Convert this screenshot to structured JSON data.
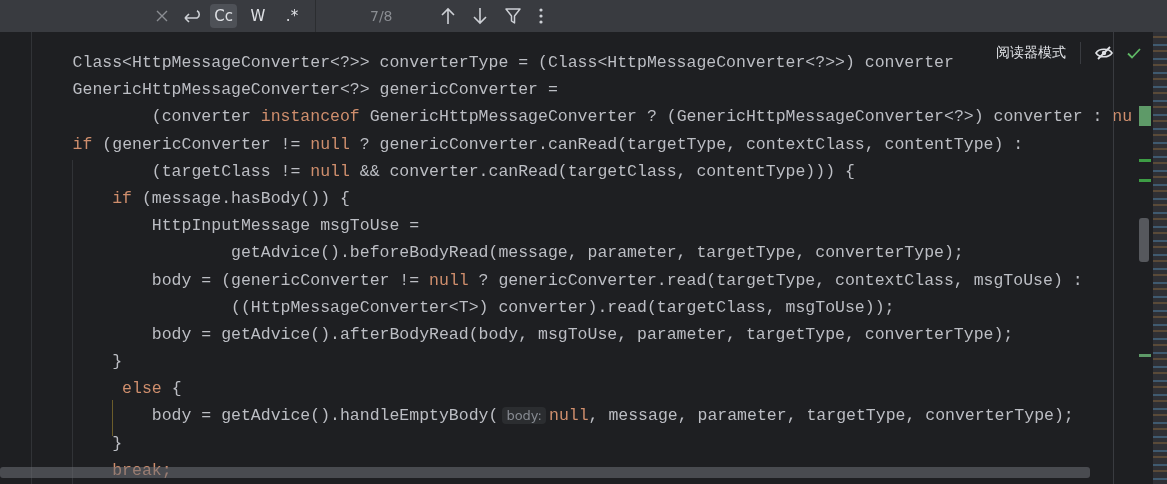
{
  "find_bar": {
    "options": [
      {
        "label": "Cc",
        "selected": true
      },
      {
        "label": "W",
        "selected": false
      },
      {
        "label": ".*",
        "selected": false
      }
    ],
    "match_count": "7/8"
  },
  "reader_mode": {
    "label": "阅读器模式"
  },
  "code_lines": [
    {
      "tokens": [
        {
          "kind": "plain",
          "text": "    Class<HttpMessageConverter<?>> converterType = (Class<HttpMessageConverter<?>>) converter"
        }
      ]
    },
    {
      "tokens": [
        {
          "kind": "plain",
          "text": "    GenericHttpMessageConverter<?> genericConverter ="
        }
      ]
    },
    {
      "tokens": [
        {
          "kind": "plain",
          "text": "            (converter "
        },
        {
          "kind": "keyword",
          "text": "instanceof"
        },
        {
          "kind": "plain",
          "text": " GenericHttpMessageConverter ? (GenericHttpMessageConverter<?>) converter : "
        },
        {
          "kind": "keyword",
          "text": "nu"
        }
      ]
    },
    {
      "tokens": [
        {
          "kind": "keyword",
          "text": "    if"
        },
        {
          "kind": "plain",
          "text": " (genericConverter != "
        },
        {
          "kind": "keyword",
          "text": "null"
        },
        {
          "kind": "plain",
          "text": " ? genericConverter.canRead(targetType, contextClass, contentType) :"
        }
      ]
    },
    {
      "tokens": [
        {
          "kind": "plain",
          "text": "            (targetClass != "
        },
        {
          "kind": "keyword",
          "text": "null"
        },
        {
          "kind": "plain",
          "text": " && converter.canRead(targetClass, contentType))) {"
        }
      ]
    },
    {
      "tokens": [
        {
          "kind": "keyword",
          "text": "        if"
        },
        {
          "kind": "plain",
          "text": " (message.hasBody()) {"
        }
      ]
    },
    {
      "tokens": [
        {
          "kind": "plain",
          "text": "            HttpInputMessage msgToUse ="
        }
      ]
    },
    {
      "tokens": [
        {
          "kind": "plain",
          "text": "                    getAdvice().beforeBodyRead(message, parameter, targetType, converterType);"
        }
      ]
    },
    {
      "tokens": [
        {
          "kind": "plain",
          "text": "            body = (genericConverter != "
        },
        {
          "kind": "keyword",
          "text": "null"
        },
        {
          "kind": "plain",
          "text": " ? genericConverter.read(targetType, contextClass, msgToUse) :"
        }
      ]
    },
    {
      "tokens": [
        {
          "kind": "plain",
          "text": "                    ((HttpMessageConverter<T>) converter).read(targetClass, msgToUse));"
        }
      ]
    },
    {
      "tokens": [
        {
          "kind": "plain",
          "text": "            body = getAdvice().afterBodyRead(body, msgToUse, parameter, targetType, converterType);"
        }
      ]
    },
    {
      "tokens": [
        {
          "kind": "plain",
          "text": "        }"
        }
      ]
    },
    {
      "tokens": [
        {
          "kind": "keyword",
          "text": "         else"
        },
        {
          "kind": "plain",
          "text": " {"
        }
      ]
    },
    {
      "tokens": [
        {
          "kind": "plain",
          "text": "            body = getAdvice().handleEmptyBody("
        },
        {
          "kind": "hint",
          "text": "body:"
        },
        {
          "kind": "keyword",
          "text": "null"
        },
        {
          "kind": "plain",
          "text": ", message, parameter, targetType, converterType);"
        }
      ]
    },
    {
      "tokens": [
        {
          "kind": "plain",
          "text": "        }"
        }
      ]
    },
    {
      "tokens": [
        {
          "kind": "keyword",
          "text": "        break;"
        }
      ]
    }
  ]
}
